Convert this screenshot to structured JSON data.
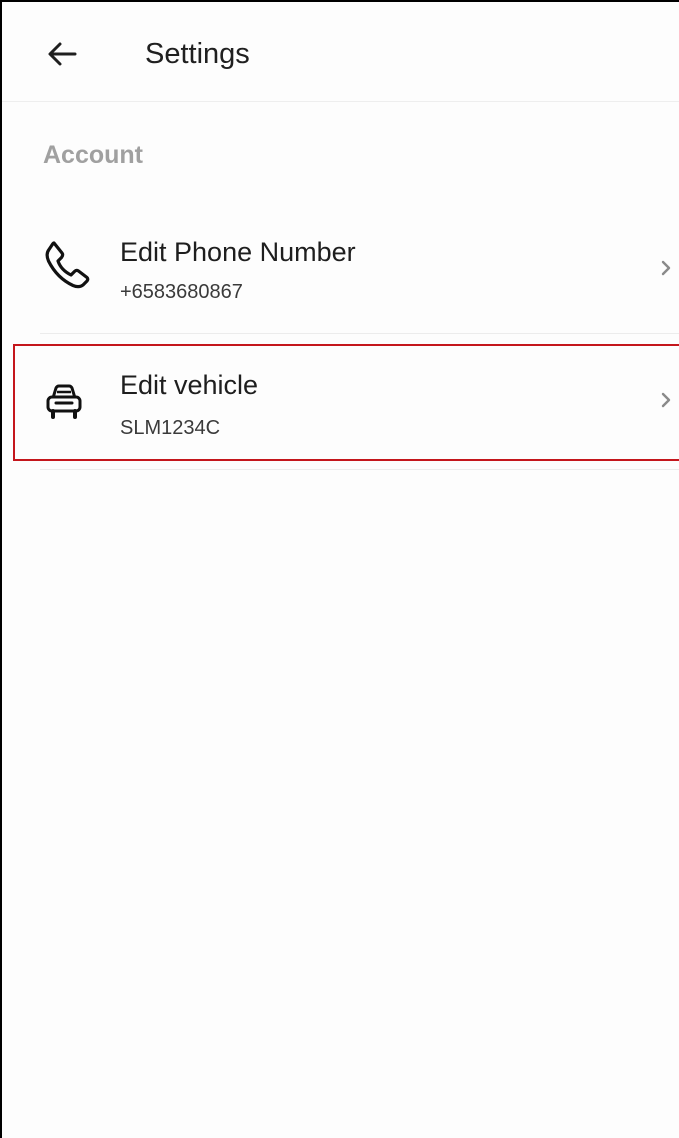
{
  "header": {
    "title": "Settings",
    "back_icon": "arrow-left-icon"
  },
  "sections": [
    {
      "label": "Account",
      "items": [
        {
          "icon": "phone-icon",
          "title": "Edit Phone Number",
          "subtitle": "+6583680867",
          "chevron": "chevron-right-icon"
        },
        {
          "icon": "car-icon",
          "title": "Edit vehicle",
          "subtitle": "SLM1234C",
          "chevron": "chevron-right-icon",
          "highlighted": true
        }
      ]
    }
  ],
  "colors": {
    "highlight_border": "#c4161c",
    "section_label": "#a0a0a0",
    "divider": "#ececec"
  }
}
